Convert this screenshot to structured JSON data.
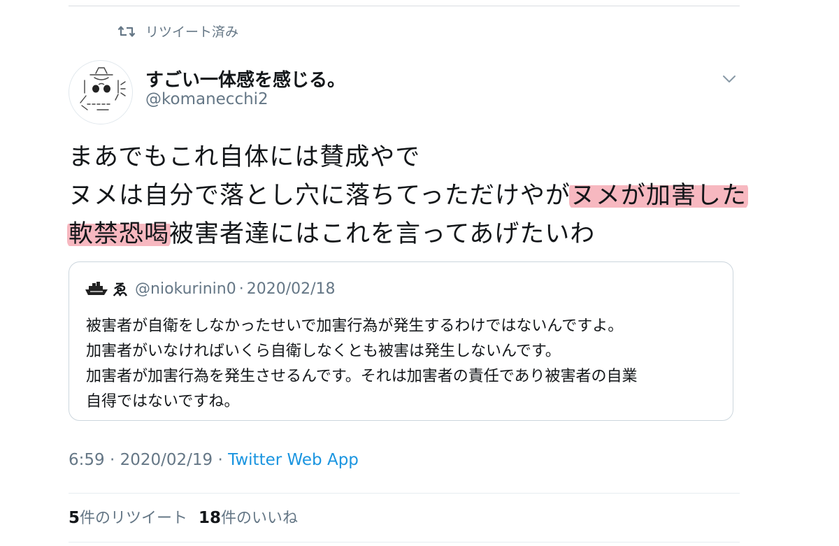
{
  "retweet_context": {
    "icon": "retweet-icon",
    "label": "リツイート済み"
  },
  "author": {
    "avatar": "ascii-art-avatar",
    "display_name": "すごい一体感を感じる。",
    "handle": "@komanecchi2"
  },
  "tweet": {
    "lines": [
      {
        "plain": "まあでもこれ自体には賛成やで"
      },
      {
        "plain": "ヌメは自分で落とし穴に落ちてっただけやが",
        "highlight": "ヌメが加害した"
      },
      {
        "highlight": "軟禁恐喝",
        "plain": "被害者達にはこれを言ってあげたいわ"
      }
    ],
    "highlight_color": "#f07d8c"
  },
  "quoted_tweet": {
    "name_icon": "ship-icon",
    "name": "ゑ",
    "handle": "@niokurinin0",
    "separator": "·",
    "date": "2020/02/18",
    "lines": [
      "被害者が自衛をしなかったせいで加害行為が発生するわけではないんですよ。",
      "加害者がいなければいくら自衛しなくとも被害は発生しないんです。",
      "加害者が加害行為を発生させるんです。それは加害者の責任であり被害者の自業",
      "自得ではないですね。"
    ]
  },
  "meta": {
    "time": "6:59",
    "sep1": "·",
    "date": "2020/02/19",
    "sep2": "·",
    "source": "Twitter Web App"
  },
  "stats": {
    "retweets_count": "5",
    "retweets_label": "件のリツイート",
    "likes_count": "18",
    "likes_label": "件のいいね"
  },
  "colors": {
    "text": "#14171a",
    "secondary": "#657786",
    "link": "#1b95e0",
    "border": "#ccd6dd"
  }
}
